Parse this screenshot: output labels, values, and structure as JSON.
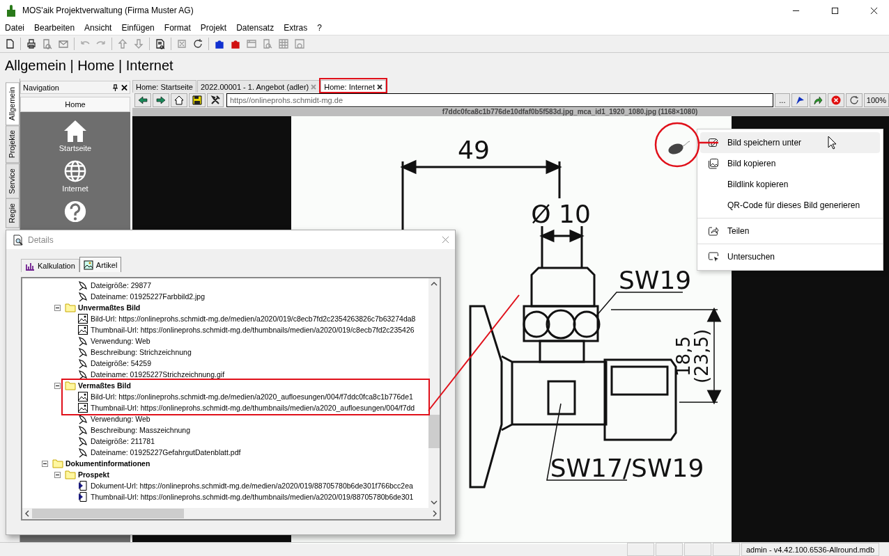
{
  "window": {
    "title": "MOS'aik Projektverwaltung (Firma Muster AG)"
  },
  "menu": [
    "Datei",
    "Bearbeiten",
    "Ansicht",
    "Einfügen",
    "Format",
    "Projekt",
    "Datensatz",
    "Extras",
    "?"
  ],
  "breadcrumb": "Allgemein | Home | Internet",
  "side_tabs": [
    {
      "label": "Allgemein",
      "selected": true
    },
    {
      "label": "Projekte",
      "selected": false
    },
    {
      "label": "Service",
      "selected": false
    },
    {
      "label": "Regie",
      "selected": false
    }
  ],
  "navigation": {
    "title": "Navigation",
    "section": "Home",
    "items": [
      {
        "kind": "home",
        "label": "Startseite"
      },
      {
        "kind": "globe",
        "label": "Internet"
      },
      {
        "kind": "help"
      }
    ]
  },
  "doc_tabs": [
    {
      "label": "Home: Startseite",
      "selected": false,
      "closable": false
    },
    {
      "label": "2022.00001 - 1. Angebot (adler)",
      "selected": false,
      "closable": true
    },
    {
      "label": "Home: Internet",
      "selected": true,
      "closable": true
    }
  ],
  "browser": {
    "url": "https//onlineprohs.schmidt-mg.de",
    "more_button": "...",
    "zoom": "100%",
    "image_caption": "f7ddc0fca8c1b776de10dfaf0b5f583d.jpg_mca_id1_1920_1080.jpg (1168×1080)",
    "image_labels": [
      "49",
      "Ø 10",
      "SW19",
      "18,5",
      "(23,5)",
      "SW17/SW19"
    ]
  },
  "context_menu": {
    "groups": [
      [
        {
          "kind": "save",
          "label": "Bild speichern unter",
          "selected": true
        },
        {
          "kind": "image",
          "label": "Bild kopieren",
          "selected": false
        },
        {
          "kind": "plain",
          "label": "Bildlink kopieren",
          "selected": false
        },
        {
          "kind": "plain",
          "label": "QR-Code für dieses Bild generieren",
          "selected": false
        }
      ],
      [
        {
          "kind": "share",
          "label": "Teilen",
          "selected": false
        }
      ],
      [
        {
          "kind": "inspect",
          "label": "Untersuchen",
          "selected": false
        }
      ]
    ]
  },
  "details": {
    "title": "Details",
    "tabs": [
      {
        "kind": "chart",
        "label": "Kalkulation",
        "selected": false
      },
      {
        "kind": "picture",
        "label": "Artikel",
        "selected": true
      }
    ],
    "tree": [
      {
        "children": [
          {
            "children": [
              {
                "kind": "property",
                "label": "Dateigröße: 29877"
              },
              {
                "kind": "property",
                "label": "Dateiname: 01925227Farbbild2.jpg"
              }
            ]
          },
          {
            "kind": "folder",
            "label": "Unvermaßtes Bild",
            "expanded": true,
            "children": [
              {
                "kind": "image",
                "label": "Bild-Url: https://onlineprohs.schmidt-mg.de/medien/a2020/019/c8ecb7fd2c2354263826c7b63274da8"
              },
              {
                "kind": "image",
                "label": "Thumbnail-Url: https://onlineprohs.schmidt-mg.de/thumbnails/medien/a2020/019/c8ecb7fd2c235426"
              },
              {
                "kind": "property",
                "label": "Verwendung: Web"
              },
              {
                "kind": "property",
                "label": "Beschreibung: Strichzeichnung"
              },
              {
                "kind": "property",
                "label": "Dateigröße: 54259"
              },
              {
                "kind": "property",
                "label": "Dateiname: 01925227Strichzeichnung.gif"
              }
            ]
          },
          {
            "kind": "folder",
            "label": "Vermaßtes Bild",
            "expanded": true,
            "children": [
              {
                "kind": "image",
                "label": "Bild-Url: https://onlineprohs.schmidt-mg.de/medien/a2020_aufloesungen/004/f7ddc0fca8c1b776de1"
              },
              {
                "kind": "image",
                "label": "Thumbnail-Url: https://onlineprohs.schmidt-mg.de/thumbnails/medien/a2020_aufloesungen/004/f7dd"
              },
              {
                "kind": "property",
                "label": "Verwendung: Web"
              },
              {
                "kind": "property",
                "label": "Beschreibung: Masszeichnung"
              },
              {
                "kind": "property",
                "label": "Dateigröße: 211781"
              },
              {
                "kind": "property",
                "label": "Dateiname: 01925227GefahrgutDatenblatt.pdf"
              }
            ]
          }
        ]
      },
      {
        "kind": "folder",
        "label": "Dokumentinformationen",
        "expanded": true,
        "children": [
          {
            "kind": "folder",
            "label": "Prospekt",
            "expanded": true,
            "children": [
              {
                "kind": "document",
                "label": "Dokument-Url: https://onlineprohs.schmidt-mg.de/medien/a2020/019/88705780b6de301f766bcc2ea"
              },
              {
                "kind": "document",
                "label": "Thumbnail-Url: https://onlineprohs.schmidt-mg.de/thumbnails/medien/a2020/019/88705780b6de301"
              }
            ]
          }
        ]
      }
    ]
  },
  "status_bar": {
    "text": "admin - v4.42.100.6536-Allround.mdb"
  }
}
